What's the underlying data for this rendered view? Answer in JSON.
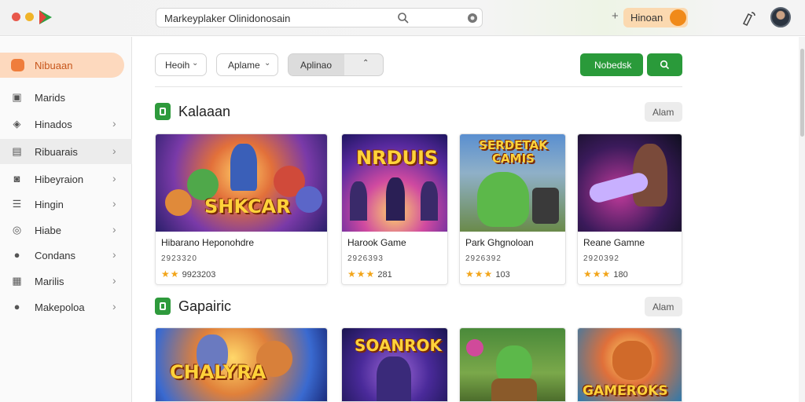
{
  "address_bar": {
    "url": "Markeyplaker Olinidonosain"
  },
  "header": {
    "user_label": "Hinoan"
  },
  "sidebar": {
    "active_label": "Nibuaan",
    "items": [
      {
        "label": "Marids",
        "icon": "box-icon",
        "has_chevron": false
      },
      {
        "label": "Hinados",
        "icon": "tag-icon",
        "has_chevron": true
      },
      {
        "label": "Ribuarais",
        "icon": "folder-icon",
        "has_chevron": true
      },
      {
        "label": "Hibeyraion",
        "icon": "car-icon",
        "has_chevron": true
      },
      {
        "label": "Hingin",
        "icon": "list-icon",
        "has_chevron": true
      },
      {
        "label": "Hiabe",
        "icon": "target-icon",
        "has_chevron": true
      },
      {
        "label": "Condans",
        "icon": "person-icon",
        "has_chevron": true
      },
      {
        "label": "Marilis",
        "icon": "chart-icon",
        "has_chevron": true
      },
      {
        "label": "Makepoloa",
        "icon": "users-icon",
        "has_chevron": true
      }
    ]
  },
  "filters": {
    "filter1": "Heoih",
    "filter2": "Aplame",
    "segment_label": "Aplinao",
    "action_label": "Nobedsk"
  },
  "sections": [
    {
      "title": "Kalaaan",
      "button": "Alam",
      "cards": [
        {
          "title": "Hibarano Heponohdre",
          "sub": "2923320",
          "rating": "9923203",
          "thumb_text": "SHKCAR",
          "stars": "★★"
        },
        {
          "title": "Harook Game",
          "sub": "2926393",
          "rating": "281",
          "thumb_text": "NRDUIS",
          "stars": "★★★"
        },
        {
          "title": "Park Ghgnoloan",
          "sub": "2926392",
          "rating": "103",
          "thumb_text": "SERDETAK CAMIS",
          "stars": "★★★"
        },
        {
          "title": "Reane Gamne",
          "sub": "2920392",
          "rating": "180",
          "thumb_text": "",
          "stars": "★★★"
        }
      ]
    },
    {
      "title": "Gapairic",
      "button": "Alam",
      "cards": [
        {
          "thumb_text": "CHALYRA"
        },
        {
          "thumb_text": "SOANROK"
        },
        {
          "thumb_text": ""
        },
        {
          "thumb_text": "GAMEROKS"
        }
      ]
    }
  ],
  "colors": {
    "accent_green": "#2a9a3a",
    "sidebar_active_bg": "#fdd9be",
    "sidebar_active_text": "#c7561b"
  }
}
